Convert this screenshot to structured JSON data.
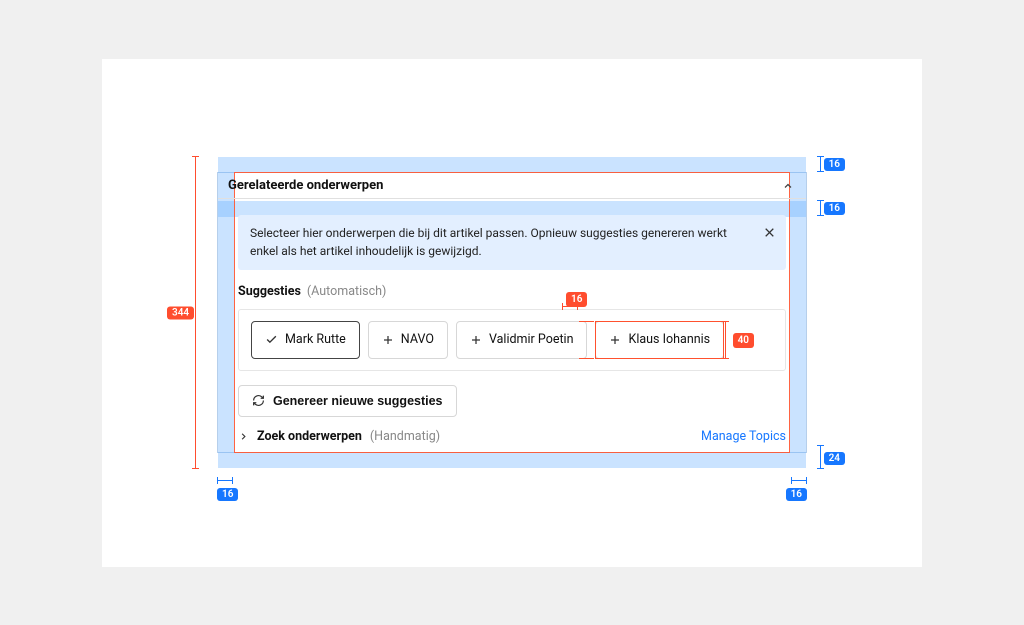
{
  "panel": {
    "title": "Gerelateerde onderwerpen",
    "info_text": "Selecteer hier onderwerpen die bij dit artikel passen. Opnieuw suggesties genereren werkt enkel als het artikel inhoudelijk is gewijzigd.",
    "section_label": "Suggesties",
    "section_sub": "(Automatisch)",
    "chips": [
      {
        "label": "Mark Rutte",
        "selected": true
      },
      {
        "label": "NAVO",
        "selected": false
      },
      {
        "label": "Validmir Poetin",
        "selected": false
      },
      {
        "label": "Klaus Iohannis",
        "selected": false
      }
    ],
    "generate_label": "Genereer nieuwe suggesties",
    "search_label": "Zoek onderwerpen",
    "search_sub": "(Handmatig)",
    "manage_link": "Manage Topics"
  },
  "measurements": {
    "panel_height": "344",
    "top_gap": "16",
    "header_gap": "16",
    "left_pad": "16",
    "right_pad": "16",
    "right_bottom": "24",
    "chip_gap": "16",
    "chip_height": "40"
  }
}
